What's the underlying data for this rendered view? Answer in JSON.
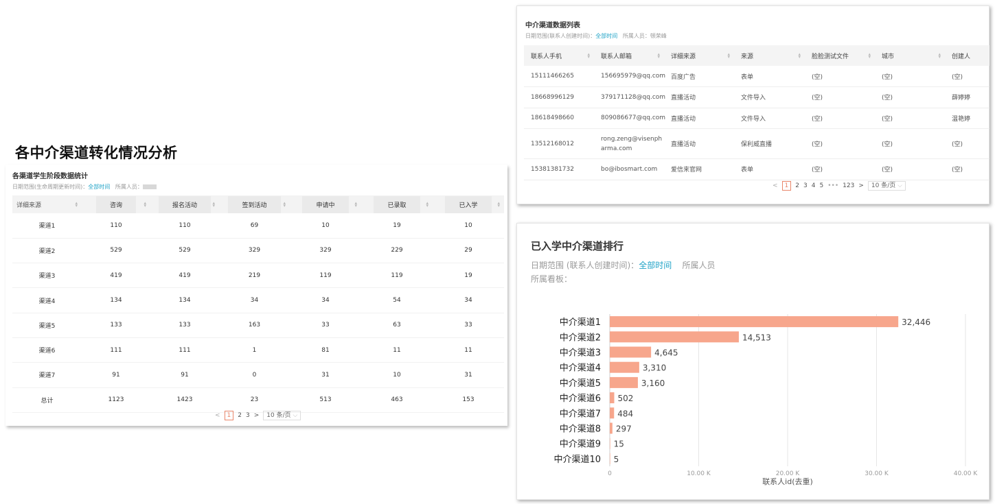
{
  "main_title": "各中介渠道转化情况分析",
  "left_panel": {
    "title": "各渠道学生阶段数据统计",
    "meta_label": "日期范围(生命周期更新时间)：",
    "meta_link": "全部时间",
    "meta_member": "所属人员：",
    "columns": [
      "详细来源",
      "咨询",
      "报名活动",
      "签到活动",
      "申请中",
      "已录取",
      "已入学"
    ],
    "rows": [
      [
        "渠道1",
        "110",
        "110",
        "69",
        "10",
        "19",
        "10"
      ],
      [
        "渠道2",
        "529",
        "529",
        "329",
        "329",
        "229",
        "29"
      ],
      [
        "渠道3",
        "419",
        "419",
        "219",
        "119",
        "119",
        "19"
      ],
      [
        "渠道4",
        "134",
        "134",
        "34",
        "34",
        "54",
        "34"
      ],
      [
        "渠道5",
        "133",
        "133",
        "163",
        "33",
        "63",
        "33"
      ],
      [
        "渠道6",
        "111",
        "111",
        "1",
        "81",
        "11",
        "11"
      ],
      [
        "渠道7",
        "91",
        "91",
        "0",
        "31",
        "10",
        "31"
      ],
      [
        "总计",
        "1123",
        "1423",
        "23",
        "513",
        "463",
        "153"
      ]
    ],
    "pager": {
      "prev": "<",
      "pages": [
        "1",
        "2",
        "3"
      ],
      "next": ">",
      "size": "10 条/页"
    }
  },
  "top_right_panel": {
    "title": "中介渠道数据列表",
    "meta_label": "日期范围(联系人创建时间)：",
    "meta_link": "全部时间",
    "meta_member": "所属人员：顿荣峰",
    "columns": [
      "联系人手机",
      "联系人邮箱",
      "详细来源",
      "来源",
      "脸脸测试文件",
      "城市",
      "创建人"
    ],
    "rows": [
      [
        "15111466265",
        "156695979@qq.com",
        "百度广告",
        "表单",
        "(空)",
        "(空)",
        "(空)"
      ],
      [
        "18668996129",
        "379171128@qq.com",
        "直播活动",
        "文件导入",
        "(空)",
        "(空)",
        "薛婷婷"
      ],
      [
        "18618498660",
        "809086677@qq.com",
        "直播活动",
        "文件导入",
        "(空)",
        "(空)",
        "温艳婷"
      ],
      [
        "13512168012",
        "rong.zeng@visenpharma.com",
        "直播活动",
        "保利威直播",
        "(空)",
        "(空)",
        "(空)"
      ],
      [
        "15381381732",
        "bo@ibosmart.com",
        "爱信来官网",
        "表单",
        "(空)",
        "(空)",
        "(空)"
      ]
    ],
    "pager": {
      "prev": "<",
      "pages": [
        "1",
        "2",
        "3",
        "4",
        "5"
      ],
      "ellipsis": "•••",
      "last": "123",
      "next": ">",
      "size": "10 条/页"
    }
  },
  "bottom_right_panel": {
    "title": "已入学中介渠道排行",
    "meta_label": "日期范围 (联系人创建时间)：",
    "meta_link": "全部时间",
    "meta_member": "所属人员",
    "meta_board": "所属看板：",
    "bar_color": "#f7a68c"
  },
  "chart_data": {
    "type": "bar",
    "orientation": "horizontal",
    "categories": [
      "中介渠道1",
      "中介渠道2",
      "中介渠道3",
      "中介渠道4",
      "中介渠道5",
      "中介渠道6",
      "中介渠道7",
      "中介渠道8",
      "中介渠道9",
      "中介渠道10"
    ],
    "values": [
      32446,
      14513,
      4645,
      3310,
      3160,
      502,
      484,
      297,
      15,
      5
    ],
    "value_labels": [
      "32,446",
      "14,513",
      "4,645",
      "3,310",
      "3,160",
      "502",
      "484",
      "297",
      "15",
      "5"
    ],
    "xlabel": "联系人id(去重)",
    "xlim": [
      0,
      40000
    ],
    "xticks": [
      0,
      10000,
      20000,
      30000,
      40000
    ],
    "xtick_labels": [
      "0",
      "10.00 K",
      "20.00 K",
      "30.00 K",
      "40.00 K"
    ],
    "grid": true
  }
}
